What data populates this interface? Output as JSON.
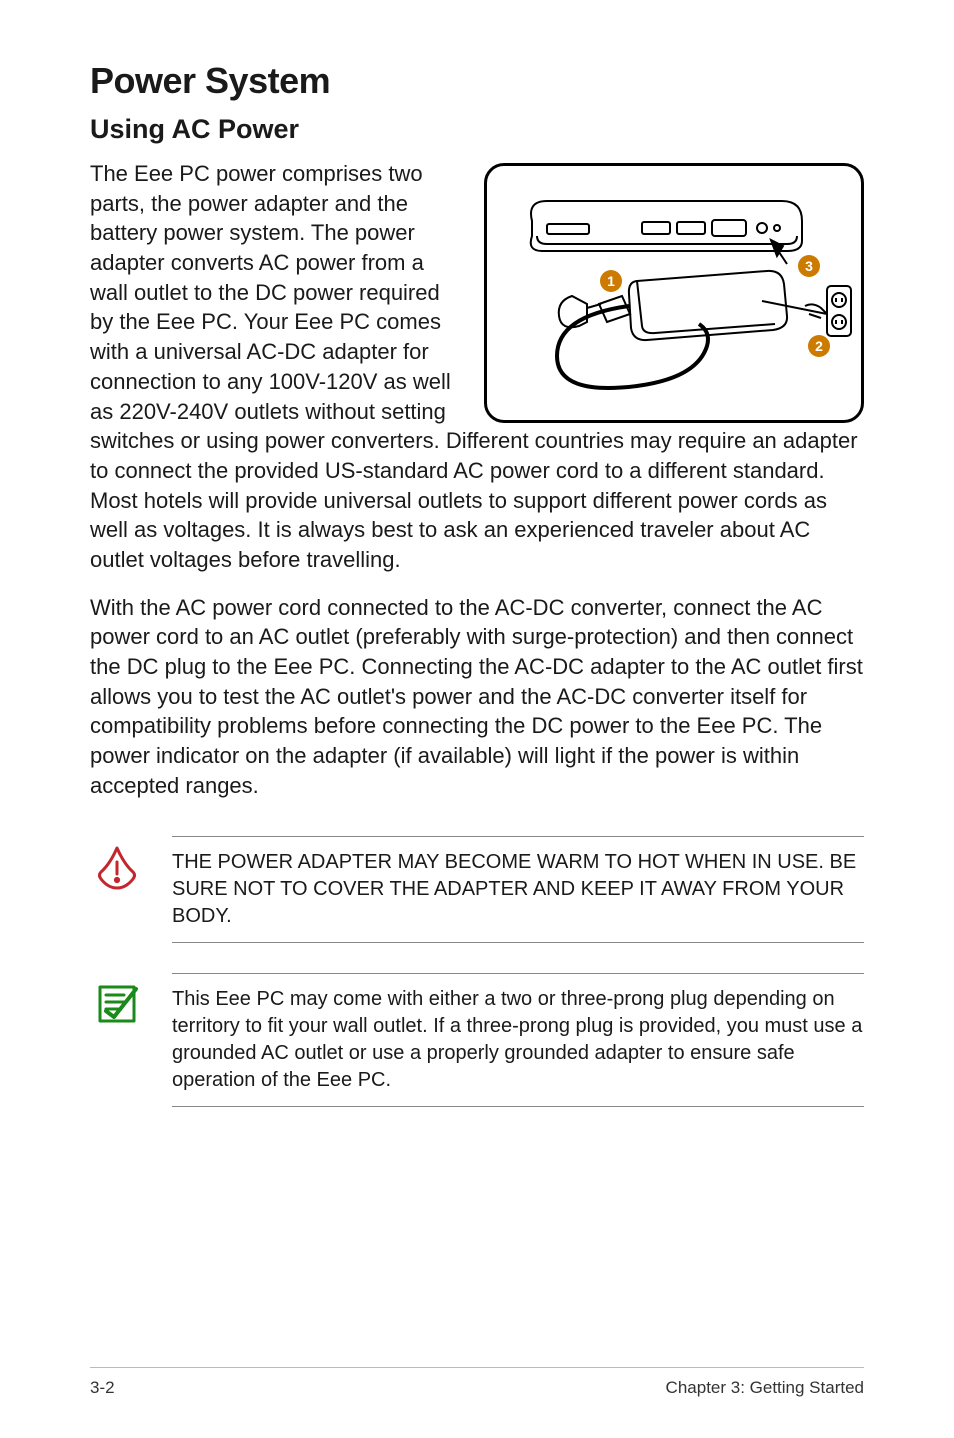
{
  "heading": "Power System",
  "subheading": "Using AC Power",
  "paragraph1": "The Eee PC power comprises two parts, the power adapter and the battery power system. The power adapter converts AC power from a wall outlet to the DC power required by the Eee PC. Your Eee PC comes with a universal AC-DC adapter for connection to any 100V-120V as well as 220V-240V outlets without setting switches or using power converters. Different countries may require an adapter to connect the provided US-standard AC power cord to a different standard. Most hotels will provide universal outlets to support different power cords as well as voltages. It is always best to ask an experienced traveler about AC outlet voltages before travelling.",
  "paragraph2": "With the AC power cord connected to the AC-DC converter, connect the AC power cord to an AC outlet (preferably with surge-protection) and then connect the DC plug to the Eee PC. Connecting the AC-DC adapter to the AC outlet first allows you to test the AC outlet's power and the AC-DC converter itself for compatibility problems before connecting the DC power to the Eee PC. The power indicator on the adapter (if available) will light if the power is within accepted ranges.",
  "callouts": {
    "warning": "THE POWER ADAPTER MAY BECOME WARM TO HOT WHEN IN USE. BE SURE NOT TO COVER THE ADAPTER AND KEEP IT AWAY FROM YOUR BODY.",
    "note": "This Eee PC may come with either a two or three-prong plug depending on territory to fit your wall outlet. If a three-prong plug is provided, you must use a grounded AC outlet or use a properly grounded adapter to ensure safe operation of the Eee PC."
  },
  "diagram": {
    "labels": {
      "one": "1",
      "two": "2",
      "three": "3"
    }
  },
  "footer": {
    "left": "3-2",
    "right": "Chapter 3: Getting Started"
  }
}
